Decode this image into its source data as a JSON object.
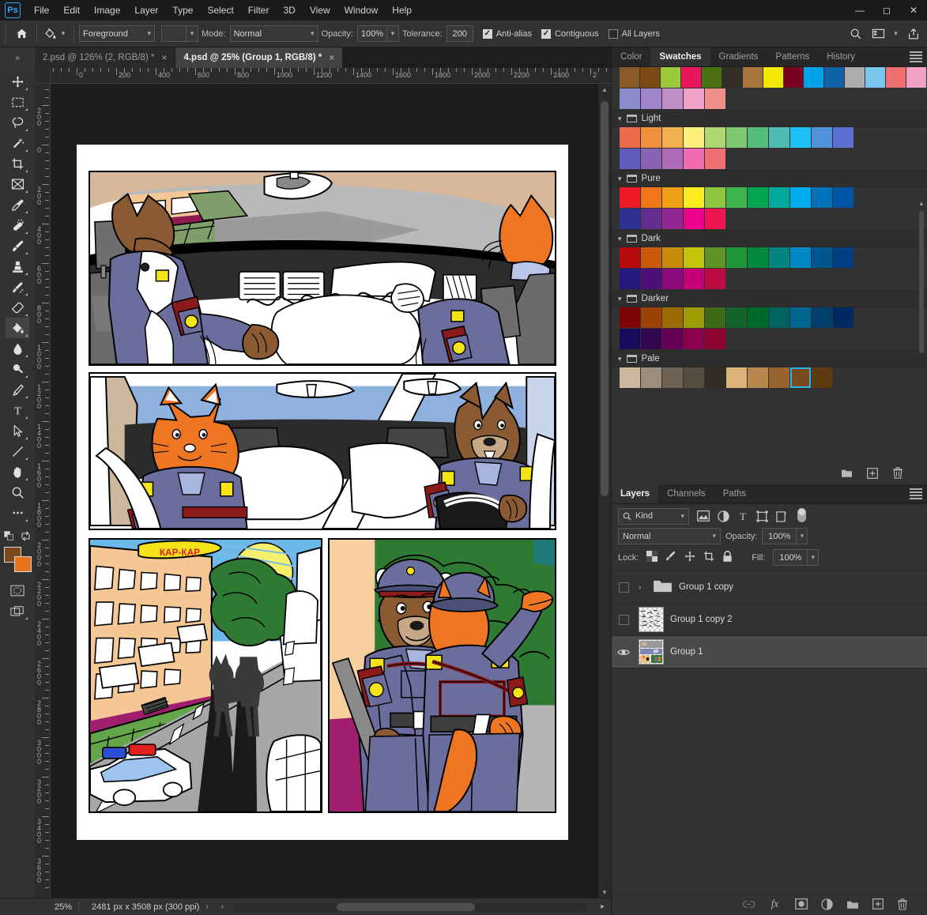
{
  "app": {
    "logo": "Ps",
    "menus": [
      "File",
      "Edit",
      "Image",
      "Layer",
      "Type",
      "Select",
      "Filter",
      "3D",
      "View",
      "Window",
      "Help"
    ],
    "window_controls": [
      "minimize",
      "maximize",
      "close"
    ]
  },
  "options_bar": {
    "home_icon": "home-icon",
    "tool_icon": "paint-bucket-icon",
    "fill_source": "Foreground",
    "pattern_swatch": "",
    "mode_label": "Mode:",
    "mode_value": "Normal",
    "opacity_label": "Opacity:",
    "opacity_value": "100%",
    "tolerance_label": "Tolerance:",
    "tolerance_value": "200",
    "antialias_label": "Anti-alias",
    "antialias_checked": true,
    "contiguous_label": "Contiguous",
    "contiguous_checked": true,
    "all_layers_label": "All Layers",
    "all_layers_checked": false,
    "right_icons": [
      "search-icon",
      "workspace-icon",
      "chevron-down-icon",
      "share-icon"
    ]
  },
  "document_tabs": [
    {
      "label": "2.psd @ 126% (2, RGB/8) *",
      "active": false,
      "close": "×"
    },
    {
      "label": "4.psd @ 25% (Group 1, RGB/8) *",
      "active": true,
      "close": "×"
    }
  ],
  "toolbar": {
    "tools": [
      {
        "name": "move-tool",
        "icon": "move"
      },
      {
        "name": "marquee-tool",
        "icon": "marquee"
      },
      {
        "name": "lasso-tool",
        "icon": "lasso"
      },
      {
        "name": "magic-wand-tool",
        "icon": "wand"
      },
      {
        "name": "crop-tool",
        "icon": "crop"
      },
      {
        "name": "frame-tool",
        "icon": "frame"
      },
      {
        "name": "eyedropper-tool",
        "icon": "eyedropper"
      },
      {
        "name": "healing-brush-tool",
        "icon": "healing"
      },
      {
        "name": "brush-tool",
        "icon": "brush"
      },
      {
        "name": "clone-stamp-tool",
        "icon": "stamp"
      },
      {
        "name": "history-brush-tool",
        "icon": "history-brush"
      },
      {
        "name": "eraser-tool",
        "icon": "eraser"
      },
      {
        "name": "paint-bucket-tool",
        "icon": "bucket",
        "active": true
      },
      {
        "name": "blur-tool",
        "icon": "blur"
      },
      {
        "name": "dodge-tool",
        "icon": "dodge"
      },
      {
        "name": "pen-tool",
        "icon": "pen"
      },
      {
        "name": "type-tool",
        "icon": "type"
      },
      {
        "name": "path-selection-tool",
        "icon": "arrow"
      },
      {
        "name": "line-tool",
        "icon": "line"
      },
      {
        "name": "hand-tool",
        "icon": "hand"
      },
      {
        "name": "zoom-tool",
        "icon": "zoom"
      },
      {
        "name": "edit-toolbar-tool",
        "icon": "ellipsis"
      }
    ],
    "foreground_color": "#7a4a1e",
    "background_color": "#e8751a",
    "quick_mask": "quick-mask-icon",
    "screen_mode": "screen-mode-icon"
  },
  "rulers": {
    "horizontal_labels": [
      "00",
      "0",
      "200",
      "400",
      "600",
      "800",
      "1000",
      "1200",
      "1400",
      "1600",
      "1800",
      "2000",
      "2200",
      "2400",
      "2"
    ],
    "vertical_labels": [
      "0",
      "200",
      "0",
      "200",
      "400",
      "600",
      "800",
      "1000",
      "1200",
      "1400",
      "1600",
      "1800",
      "2000",
      "2200",
      "2400",
      "2600",
      "2800",
      "3000",
      "3200",
      "3400",
      "3600"
    ]
  },
  "canvas": {
    "document_name": "4.psd",
    "speech_bubble_text": "КАР-КАР",
    "panels": [
      {
        "name": "panel-1-car-interior"
      },
      {
        "name": "panel-2-two-officers-driving"
      },
      {
        "name": "panel-3-street-shadows"
      },
      {
        "name": "panel-4-two-officers-pointing"
      }
    ]
  },
  "status_bar": {
    "zoom": "25%",
    "doc_info": "2481 px x 3508 px (300 ppi)",
    "next_arrow": "›",
    "prev_arrow": "‹"
  },
  "swatches_panel": {
    "tabs": [
      {
        "label": "Color",
        "active": false
      },
      {
        "label": "Swatches",
        "active": true
      },
      {
        "label": "Gradients",
        "active": false
      },
      {
        "label": "Patterns",
        "active": false
      },
      {
        "label": "History",
        "active": false
      }
    ],
    "menu_icon": "panel-menu-icon",
    "recent_row": [
      "#8a5a28",
      "#7a4a12",
      "#9cc93a",
      "#e8165c",
      "#4a7012",
      "#332e26",
      "#a8763c",
      "#f5e800",
      "#780020",
      "#00a2e8",
      "#1062a8",
      "#adadad",
      "#7ac8f0",
      "#ee7070",
      "#f2a0c8"
    ],
    "recent_row2": [
      "#8a8acd",
      "#9f86c8",
      "#bf8ec8",
      "#f2a0c8",
      "#ee9088"
    ],
    "groups": [
      {
        "name": "Light",
        "rows": [
          [
            "#ec6b4a",
            "#f0903f",
            "#f0b04f",
            "#fcf07a",
            "#aed671",
            "#80c972",
            "#54bd7e",
            "#4cbcb4",
            "#1ec0f5",
            "#4f94d9",
            "#5c6fd1"
          ],
          [
            "#5f5cbe",
            "#8a62b4",
            "#b06bb8",
            "#f06bb0",
            "#ee7070"
          ]
        ]
      },
      {
        "name": "Pure",
        "rows": [
          [
            "#ed1c24",
            "#f07617",
            "#f0a015",
            "#fcee21",
            "#8cc63f",
            "#3db54a",
            "#00a551",
            "#00a99d",
            "#00adef",
            "#0072bc",
            "#0054a6"
          ],
          [
            "#2e3192",
            "#662d91",
            "#92278f",
            "#ec008c",
            "#ed1651"
          ]
        ]
      },
      {
        "name": "Dark",
        "rows": [
          [
            "#b50a0d",
            "#c85a0a",
            "#c68c0a",
            "#c4c40c",
            "#5d9425",
            "#1f9638",
            "#00883c",
            "#008480",
            "#0089c4",
            "#00578f",
            "#003e82"
          ],
          [
            "#241a7d",
            "#4c1078",
            "#8a0a7a",
            "#c40078",
            "#bd0c42"
          ]
        ]
      },
      {
        "name": "Darker",
        "rows": [
          [
            "#7d0508",
            "#9c4205",
            "#9c6c02",
            "#9c9c05",
            "#3d6a16",
            "#13642a",
            "#006a2c",
            "#00625e",
            "#00658f",
            "#003f6c",
            "#002b62"
          ],
          [
            "#180a58",
            "#330650",
            "#640256",
            "#8c0050",
            "#8c0530"
          ]
        ]
      },
      {
        "name": "Pale",
        "rows": [
          [
            "#cbb89e",
            "#9d8d7c",
            "#6e6255",
            "#574c40",
            "#332c24",
            "#dbb277",
            "#b8874c",
            "#996330",
            "#7a4a1e",
            "#5e3a10"
          ]
        ]
      }
    ],
    "selected_swatch": "#7a4a1e",
    "footer_icons": [
      "new-group-icon",
      "new-swatch-icon",
      "delete-swatch-icon"
    ]
  },
  "layers_panel": {
    "tabs": [
      {
        "label": "Layers",
        "active": true
      },
      {
        "label": "Channels",
        "active": false
      },
      {
        "label": "Paths",
        "active": false
      }
    ],
    "menu_icon": "panel-menu-icon",
    "filter_kind": "Kind",
    "filter_icons": [
      "pixel-filter-icon",
      "adjustment-filter-icon",
      "type-filter-icon",
      "shape-filter-icon",
      "smart-object-filter-icon"
    ],
    "filter_toggle": "filter-toggle-switch",
    "blend_mode": "Normal",
    "opacity_label": "Opacity:",
    "opacity_value": "100%",
    "lock_label": "Lock:",
    "lock_icons": [
      "lock-transparent-icon",
      "lock-image-icon",
      "lock-position-icon",
      "lock-artboard-icon",
      "lock-all-icon"
    ],
    "fill_label": "Fill:",
    "fill_value": "100%",
    "rows": [
      {
        "name": "Group 1 copy",
        "visible": false,
        "selected": false,
        "type": "group",
        "expanded": false
      },
      {
        "name": "Group 1 copy 2",
        "visible": false,
        "selected": false,
        "type": "layer"
      },
      {
        "name": "Group 1",
        "visible": true,
        "selected": true,
        "type": "layer"
      }
    ],
    "footer_icons": [
      "link-layers-icon",
      "layer-style-fx-icon",
      "layer-mask-icon",
      "adjustment-layer-icon",
      "new-group-icon",
      "new-layer-icon",
      "delete-layer-icon"
    ]
  }
}
